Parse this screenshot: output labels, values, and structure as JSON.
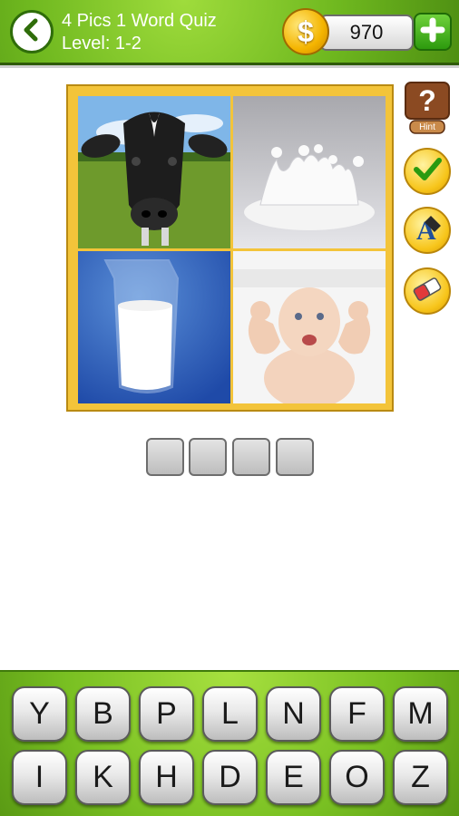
{
  "header": {
    "title": "4 Pics 1 Word Quiz",
    "level": "Level: 1-2",
    "coins": "970",
    "coin_symbol": "$",
    "back_icon": "chevron-left-icon",
    "add_icon": "plus-icon"
  },
  "puzzle": {
    "pictures": [
      {
        "subject": "cow"
      },
      {
        "subject": "milk splash crown"
      },
      {
        "subject": "glass of milk"
      },
      {
        "subject": "baby flexing"
      }
    ]
  },
  "side_buttons": {
    "hint_label": "Hint",
    "hint_icon": "question-mark-icon",
    "check_icon": "checkmark-icon",
    "reveal_icon": "letter-reveal-icon",
    "erase_icon": "eraser-icon"
  },
  "answer": {
    "length": 4,
    "slots": [
      "",
      "",
      "",
      ""
    ]
  },
  "keyboard": {
    "row1": [
      "Y",
      "B",
      "P",
      "L",
      "N",
      "F",
      "M"
    ],
    "row2": [
      "I",
      "K",
      "H",
      "D",
      "E",
      "O",
      "Z"
    ]
  },
  "colors": {
    "header_green": "#6fb81f",
    "frame_gold": "#f3c43a",
    "coin_gold": "#f4b400",
    "button_green": "#2d9a0e"
  }
}
